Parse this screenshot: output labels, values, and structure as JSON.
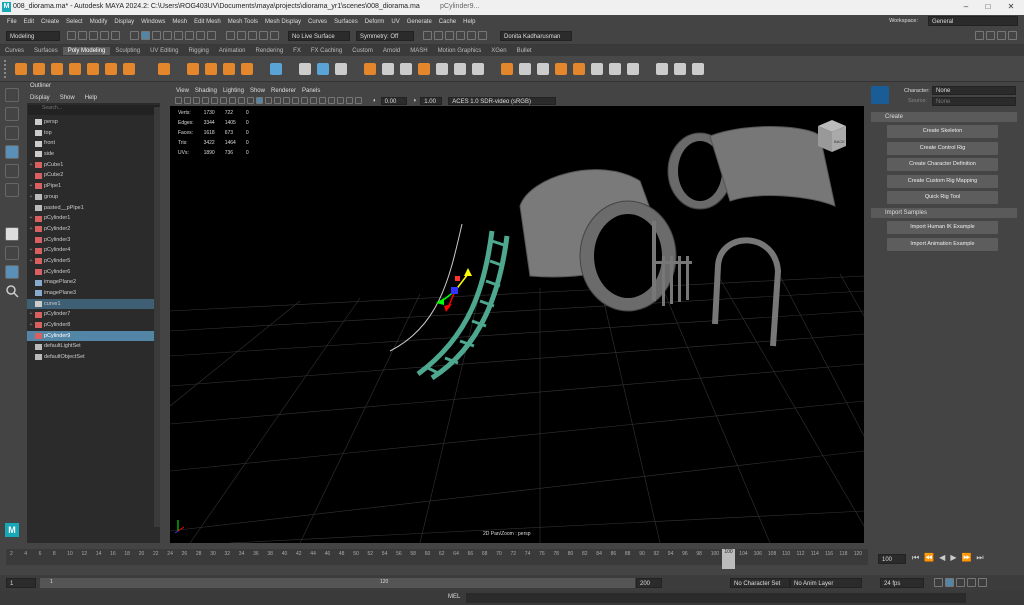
{
  "window": {
    "title": "008_diorama.ma* - Autodesk MAYA 2024.2: C:\\Users\\ROG403UV\\Documents\\maya\\projects\\diorama_yr1\\scenes\\008_diorama.ma",
    "selection": "pCylinder9..."
  },
  "menus": [
    "File",
    "Edit",
    "Create",
    "Select",
    "Modify",
    "Display",
    "Windows",
    "Mesh",
    "Edit Mesh",
    "Mesh Tools",
    "Mesh Display",
    "Curves",
    "Surfaces",
    "Deform",
    "UV",
    "Generate",
    "Cache",
    "Help"
  ],
  "workspace": {
    "label": "Workspace:",
    "value": "General"
  },
  "status": {
    "mode": "Modeling",
    "live_surface": "No Live Surface",
    "symmetry": "Symmetry: Off",
    "user": "Donita Kadharusman"
  },
  "shelf_tabs": [
    "Curves",
    "Surfaces",
    "Poly Modeling",
    "Sculpting",
    "UV Editing",
    "Rigging",
    "Animation",
    "Rendering",
    "FX",
    "FX Caching",
    "Custom",
    "Arnold",
    "MASH",
    "Motion Graphics",
    "XGen",
    "Bullet"
  ],
  "shelf_active": "Poly Modeling",
  "outliner": {
    "title": "Outliner",
    "menus": [
      "Display",
      "Show",
      "Help"
    ],
    "search_placeholder": "Search...",
    "items": [
      {
        "label": "persp",
        "expand": "",
        "icon": "camera",
        "state": ""
      },
      {
        "label": "top",
        "expand": "",
        "icon": "camera",
        "state": ""
      },
      {
        "label": "front",
        "expand": "",
        "icon": "camera",
        "state": ""
      },
      {
        "label": "side",
        "expand": "",
        "icon": "camera",
        "state": ""
      },
      {
        "label": "pCube1",
        "expand": "+",
        "icon": "mesh",
        "state": ""
      },
      {
        "label": "pCube2",
        "expand": "",
        "icon": "mesh",
        "state": ""
      },
      {
        "label": "pPipe1",
        "expand": "+",
        "icon": "mesh",
        "state": ""
      },
      {
        "label": "group",
        "expand": "+",
        "icon": "group",
        "state": ""
      },
      {
        "label": "pasted__pPipe1",
        "expand": "",
        "icon": "group",
        "state": ""
      },
      {
        "label": "pCylinder1",
        "expand": "+",
        "icon": "mesh",
        "state": ""
      },
      {
        "label": "pCylinder2",
        "expand": "+",
        "icon": "mesh",
        "state": ""
      },
      {
        "label": "pCylinder3",
        "expand": "",
        "icon": "mesh",
        "state": ""
      },
      {
        "label": "pCylinder4",
        "expand": "+",
        "icon": "mesh",
        "state": ""
      },
      {
        "label": "pCylinder5",
        "expand": "+",
        "icon": "mesh",
        "state": ""
      },
      {
        "label": "pCylinder6",
        "expand": "",
        "icon": "mesh",
        "state": ""
      },
      {
        "label": "imagePlane2",
        "expand": "",
        "icon": "image",
        "state": ""
      },
      {
        "label": "imagePlane3",
        "expand": "",
        "icon": "image",
        "state": ""
      },
      {
        "label": "curve1",
        "expand": "",
        "icon": "curve",
        "state": "hl"
      },
      {
        "label": "pCylinder7",
        "expand": "+",
        "icon": "mesh",
        "state": ""
      },
      {
        "label": "pCylinder8",
        "expand": "+",
        "icon": "mesh",
        "state": ""
      },
      {
        "label": "pCylinder9",
        "expand": "",
        "icon": "mesh",
        "state": "sel"
      },
      {
        "label": "defaultLightSet",
        "expand": "",
        "icon": "set",
        "state": ""
      },
      {
        "label": "defaultObjectSet",
        "expand": "",
        "icon": "set",
        "state": ""
      }
    ]
  },
  "viewport": {
    "menus": [
      "View",
      "Shading",
      "Lighting",
      "Show",
      "Renderer",
      "Panels"
    ],
    "exposure": "0.00",
    "gamma": "1.00",
    "color_space": "ACES 1.0 SDR-video (sRGB)",
    "hud": [
      {
        "label": "Verts:",
        "a": "1730",
        "b": "722",
        "c": "0"
      },
      {
        "label": "Edges:",
        "a": "3344",
        "b": "1405",
        "c": "0"
      },
      {
        "label": "Faces:",
        "a": "1618",
        "b": "673",
        "c": "0"
      },
      {
        "label": "Tris:",
        "a": "3422",
        "b": "1464",
        "c": "0"
      },
      {
        "label": "UVs:",
        "a": "1890",
        "b": "736",
        "c": "0"
      }
    ],
    "camera_label": "2D Pan/Zoom : persp",
    "cube_label": "BACK"
  },
  "right_panel": {
    "character_label": "Character:",
    "character_value": "None",
    "source_label": "Source:",
    "source_value": "None",
    "create_header": "Create",
    "create_buttons": [
      "Create Skeleton",
      "Create Control Rig",
      "Create Character Definition",
      "Create Custom Rig Mapping",
      "Quick Rig Tool"
    ],
    "import_header": "Import Samples",
    "import_buttons": [
      "Import Human IK Example",
      "Import Animation Example"
    ]
  },
  "timeline": {
    "ticks": [
      "2",
      "4",
      "6",
      "8",
      "10",
      "12",
      "14",
      "16",
      "18",
      "20",
      "22",
      "24",
      "26",
      "28",
      "30",
      "32",
      "34",
      "36",
      "38",
      "40",
      "42",
      "44",
      "46",
      "48",
      "50",
      "52",
      "54",
      "56",
      "58",
      "60",
      "62",
      "64",
      "66",
      "68",
      "70",
      "72",
      "74",
      "76",
      "78",
      "80",
      "82",
      "84",
      "86",
      "88",
      "90",
      "92",
      "94",
      "96",
      "98",
      "100",
      "102",
      "104",
      "106",
      "108",
      "110",
      "112",
      "114",
      "116",
      "118",
      "120"
    ],
    "current_frame": "100",
    "frame_field": "100"
  },
  "range": {
    "start": "1",
    "inner_start": "1",
    "inner_end": "120",
    "end": "200",
    "character_set": "No Character Set",
    "anim_layer": "No Anim Layer",
    "fps": "24 fps"
  },
  "cmdline": {
    "lang": "MEL"
  },
  "colors": {
    "accent": "#5285a6",
    "shelf_icon": "#e3862c",
    "mesh_green": "#4ea890",
    "viewport_bg": "#000000"
  }
}
